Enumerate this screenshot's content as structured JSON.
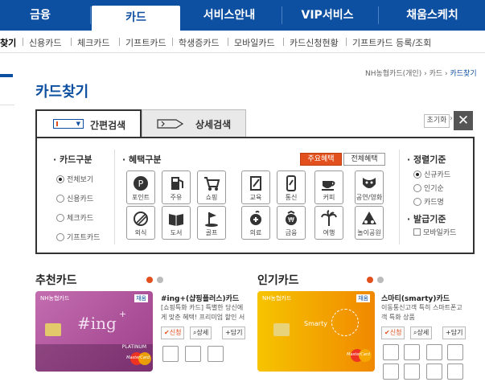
{
  "nav": {
    "tabs": [
      {
        "label": "금융"
      },
      {
        "label": "카드"
      },
      {
        "label": "서비스안내"
      },
      {
        "label": "VIP서비스"
      },
      {
        "label": "채움스케치"
      }
    ]
  },
  "subnav": {
    "items": [
      {
        "label": "찾기"
      },
      {
        "label": "신용카드"
      },
      {
        "label": "체크카드"
      },
      {
        "label": "기프트카드"
      },
      {
        "label": "학생증카드"
      },
      {
        "label": "모바일카드"
      },
      {
        "label": "카드신청현황"
      },
      {
        "label": "기프트카드 등록/조회"
      }
    ]
  },
  "breadcrumb": {
    "root": "NH농협카드(개인)",
    "sep": "›",
    "mid": "카드",
    "current": "카드찾기"
  },
  "page_title": "카드찾기",
  "search": {
    "tab_simple": "간편검색",
    "tab_detail": "상세검색",
    "reset": "초기화",
    "close": "✕",
    "card_type": {
      "title": "· 카드구분",
      "options": [
        {
          "label": "전체보기",
          "checked": true
        },
        {
          "label": "신용카드",
          "checked": false
        },
        {
          "label": "체크카드",
          "checked": false
        },
        {
          "label": "기프트카드",
          "checked": false
        }
      ]
    },
    "benefit": {
      "title": "· 혜택구분",
      "btn_main": "주요혜택",
      "btn_all": "전체혜택",
      "row1": [
        {
          "label": "포인트",
          "icon": "piggy-bank-icon"
        },
        {
          "label": "주유",
          "icon": "fuel-icon"
        },
        {
          "label": "쇼핑",
          "icon": "cart-icon"
        },
        {
          "label": "교육",
          "icon": "pencil-icon"
        },
        {
          "label": "통신",
          "icon": "phone-icon"
        },
        {
          "label": "커피",
          "icon": "coffee-icon"
        },
        {
          "label": "공연/영화",
          "icon": "theater-icon"
        }
      ],
      "row2": [
        {
          "label": "외식",
          "icon": "dining-icon"
        },
        {
          "label": "도서",
          "icon": "book-icon"
        },
        {
          "label": "골프",
          "icon": "golf-icon"
        },
        {
          "label": "의료",
          "icon": "medical-icon"
        },
        {
          "label": "금융",
          "icon": "bank-icon"
        },
        {
          "label": "여행",
          "icon": "palm-tree-icon"
        },
        {
          "label": "놀이공원",
          "icon": "amusement-icon"
        }
      ]
    },
    "sort": {
      "title": "· 정렬기준",
      "options": [
        {
          "label": "신규카드",
          "checked": true
        },
        {
          "label": "인기순",
          "checked": false
        },
        {
          "label": "카드명",
          "checked": false
        }
      ]
    },
    "issue": {
      "title": "· 발급기준",
      "mobile": "모바일카드"
    }
  },
  "recommend": {
    "title": "추천카드",
    "card_name": "#ing+(샵핑플러스)카드",
    "desc1": "[쇼핑특화 카드] 특별한 당신에",
    "desc2": "게 맞춘 혜택! 프리미엄 할인 서",
    "card_text": "#ing",
    "card_brand": "NH농협카드",
    "card_chae": "채움",
    "card_platinum": "PLATINUM",
    "card_network": "MasterCard"
  },
  "popular": {
    "title": "인기카드",
    "card_name": "스마티(smarty)카드",
    "desc1": "이동통신고객 특히 스마트폰고",
    "desc2": "객 특화 상품",
    "card_text": "Smarty",
    "card_brand": "NH농협카드",
    "card_chae": "채움",
    "card_network": "MasterCard"
  },
  "actions": {
    "apply": "✔신청",
    "detail": "상세",
    "save": "+담기"
  },
  "colors": {
    "brand_blue": "#0d4fa1",
    "accent_orange": "#e2511d",
    "recommend_card": "#b85a9f",
    "popular_card": "#f2a400"
  }
}
